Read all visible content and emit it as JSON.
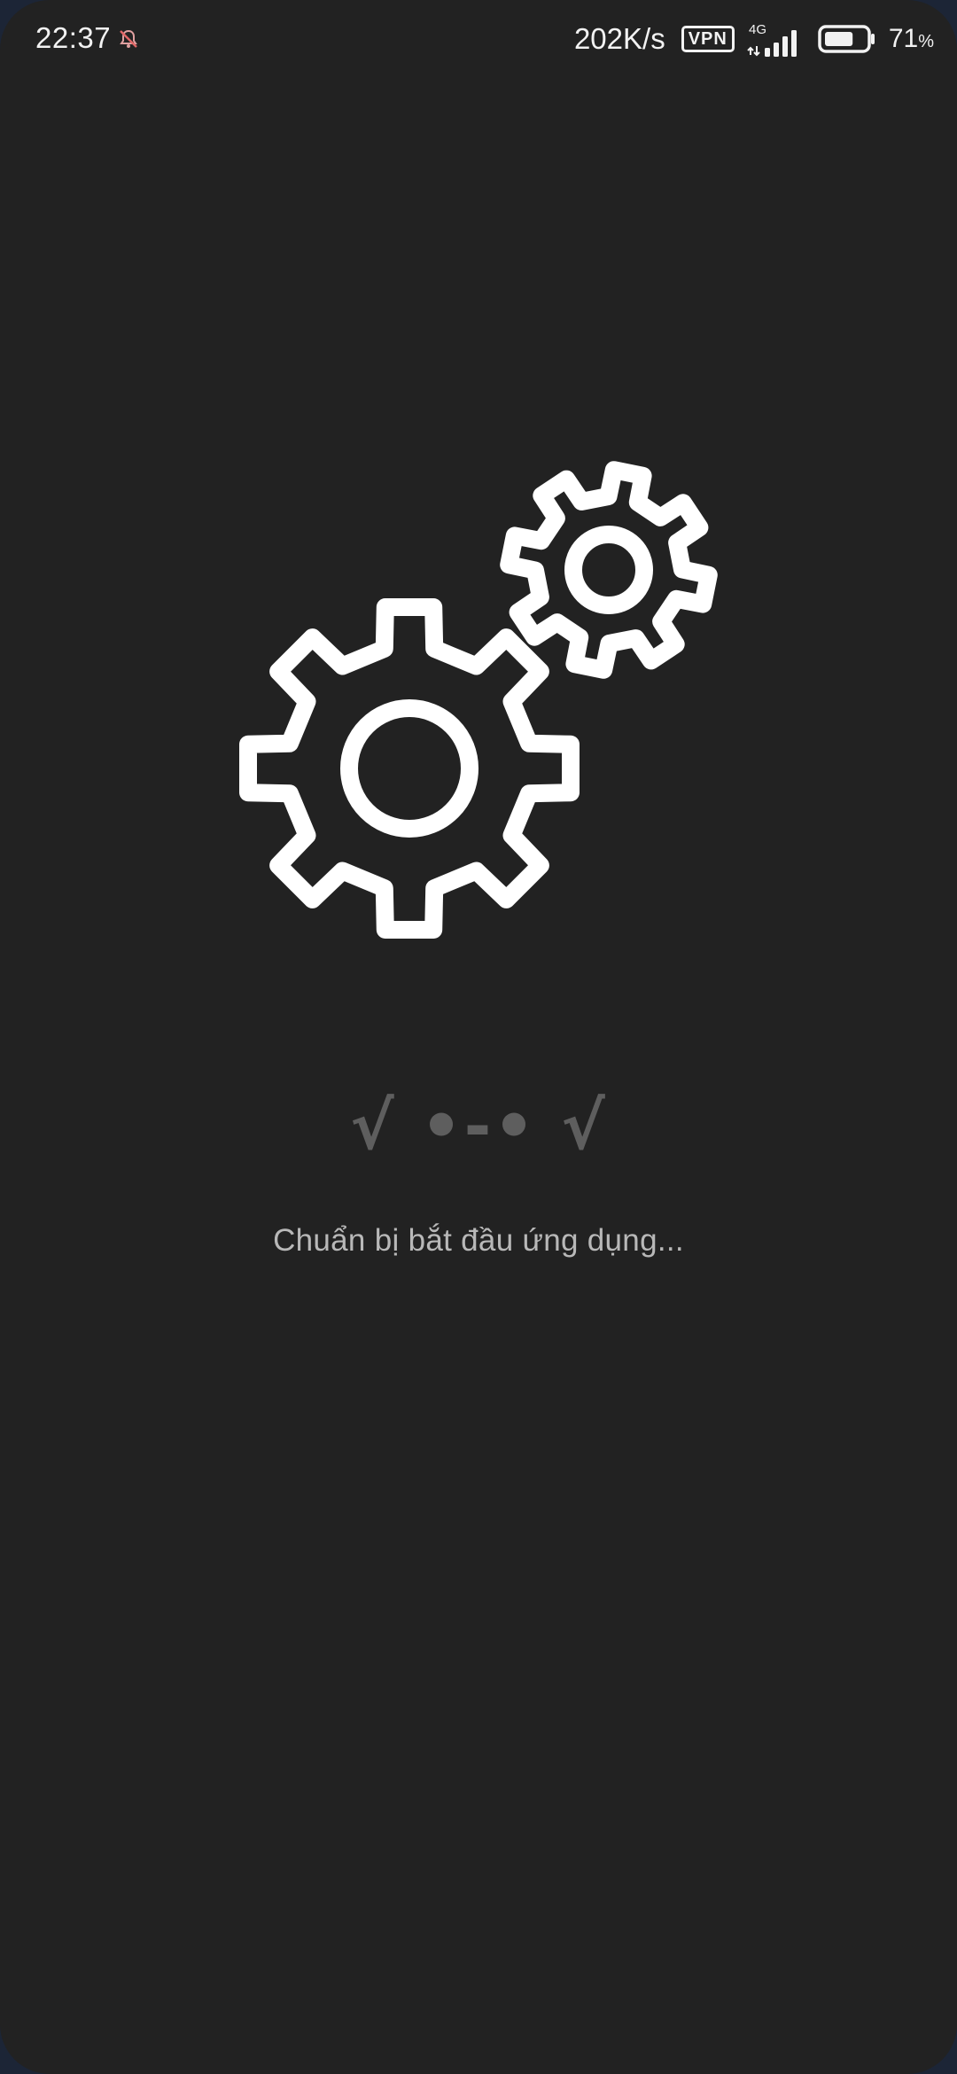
{
  "status_bar": {
    "time": "22:37",
    "muted_icon": "notification-off-icon",
    "net_speed": "202K/s",
    "vpn_label": "VPN",
    "network_type": "4G",
    "signal_icon": "signal-strength-icon",
    "battery_icon": "battery-icon",
    "battery_level": 0.71,
    "battery_value": "71",
    "battery_unit": "%"
  },
  "main": {
    "illustration_icon": "gears-icon",
    "kaomoji": "√ •-• √",
    "loading_text": "Chuẩn bị bắt đầu ứng dụng..."
  },
  "colors": {
    "background": "#222222",
    "icon": "#ffffff",
    "kaomoji": "#5e5e5e",
    "loading_text": "#b8b8b8"
  }
}
